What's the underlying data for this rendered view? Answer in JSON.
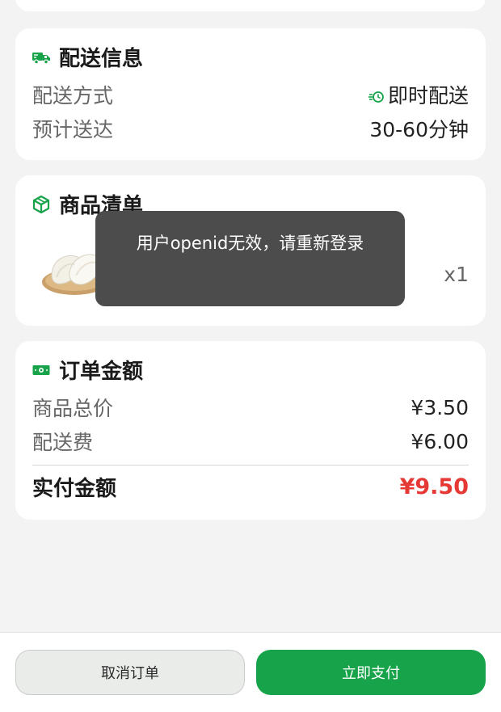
{
  "delivery": {
    "title": "配送信息",
    "method_label": "配送方式",
    "method_value": "即时配送",
    "eta_label": "预计送达",
    "eta_value": "30-60分钟"
  },
  "goods": {
    "title": "商品清单",
    "items": [
      {
        "quantity": "x1"
      }
    ]
  },
  "amount": {
    "title": "订单金额",
    "subtotal_label": "商品总价",
    "subtotal_value": "¥3.50",
    "shipping_label": "配送费",
    "shipping_value": "¥6.00",
    "total_label": "实付金额",
    "total_value": "¥9.50"
  },
  "toast": {
    "message": "用户openid无效，请重新登录"
  },
  "actions": {
    "cancel_label": "取消订单",
    "pay_label": "立即支付"
  },
  "colors": {
    "brand_green": "#17a34a",
    "price_red": "#e53935",
    "toast_bg": "#4c4c4c"
  },
  "icons": {
    "delivery": "delivery-truck-icon",
    "goods": "package-box-icon",
    "amount": "money-bill-icon",
    "instant": "clock-speed-icon"
  }
}
